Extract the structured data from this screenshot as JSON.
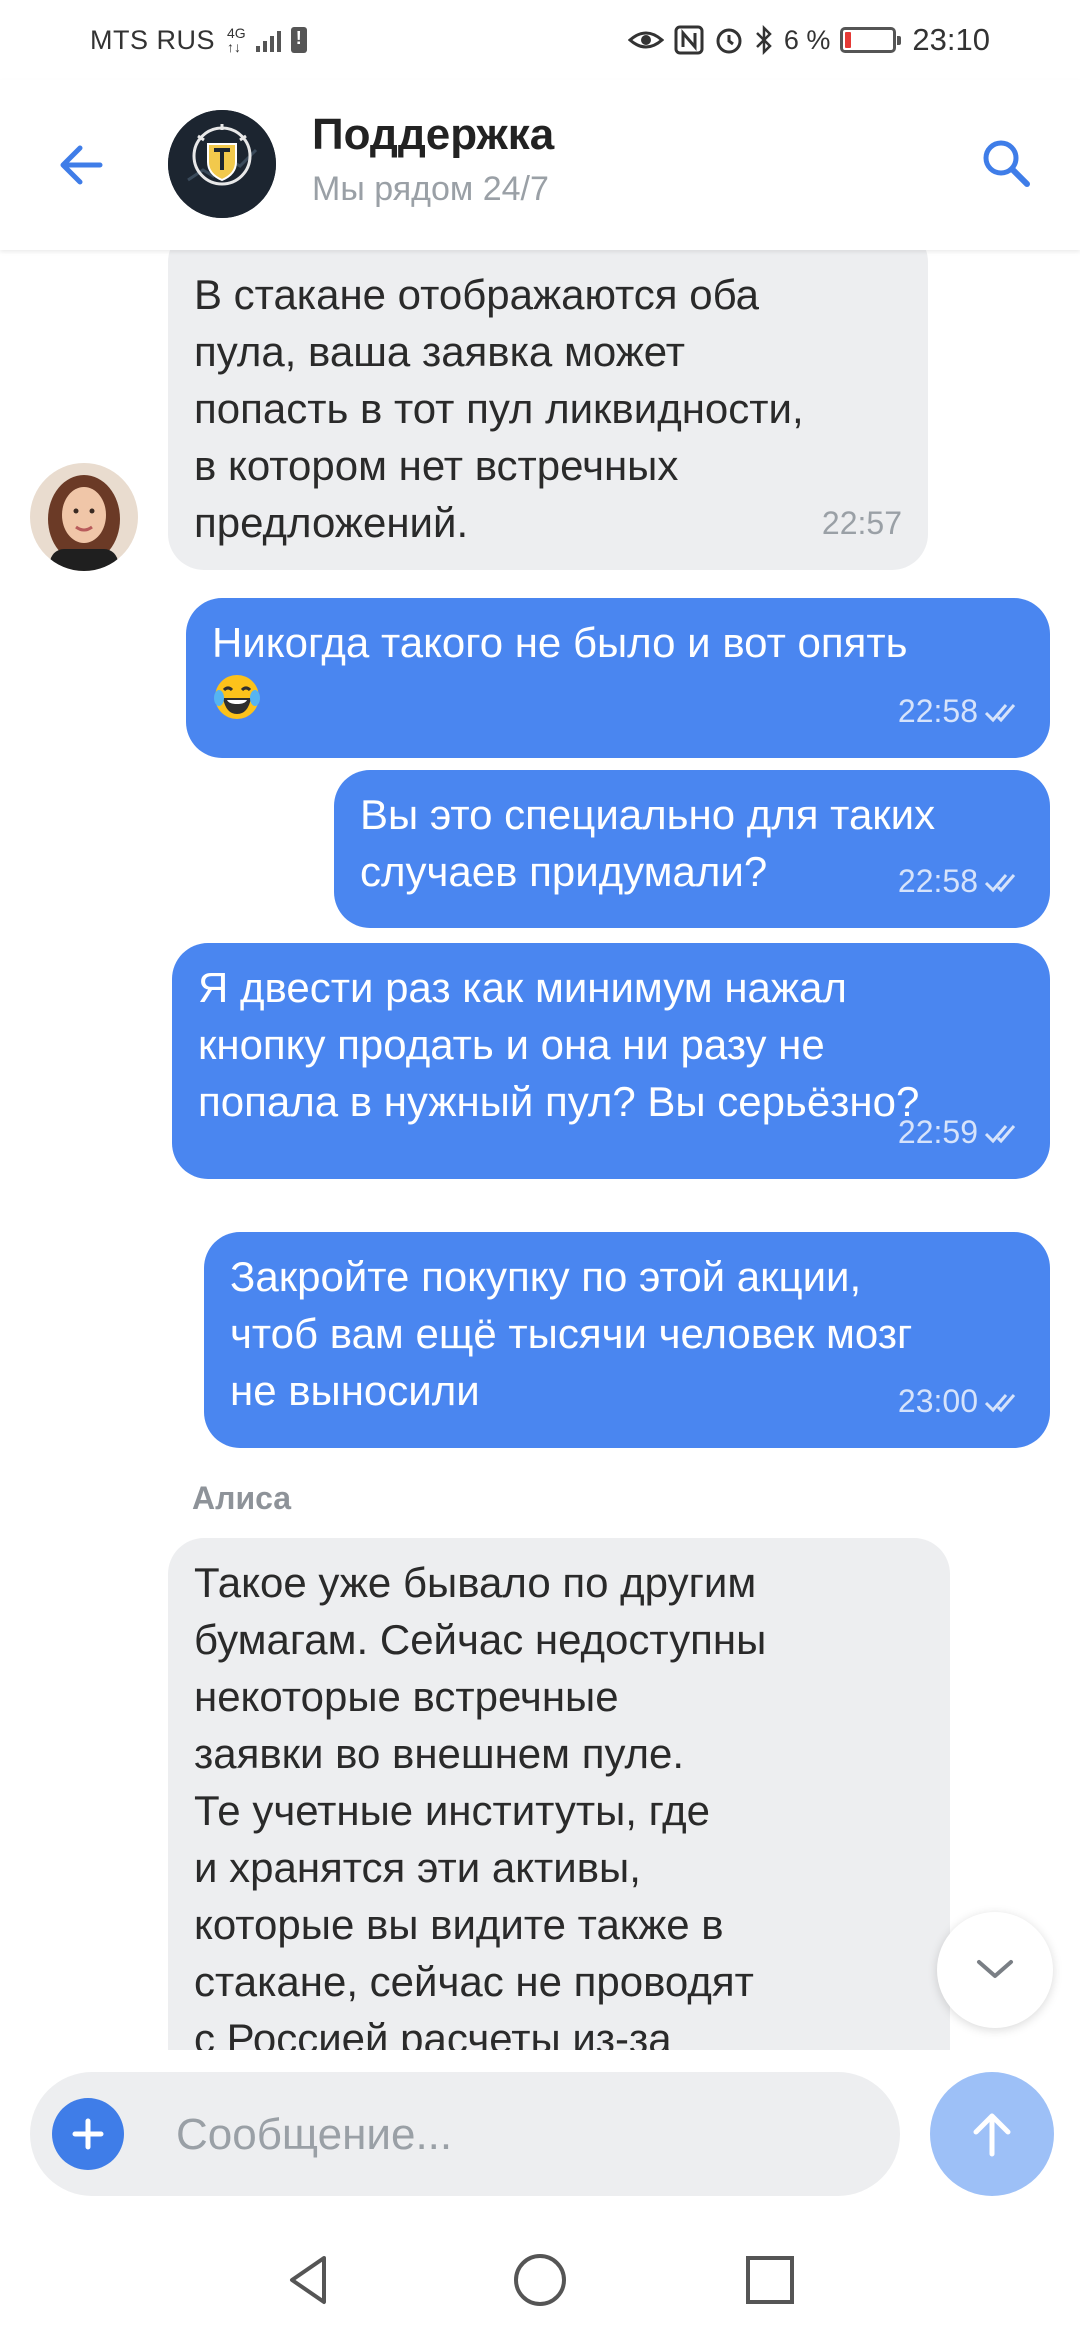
{
  "status_bar": {
    "carrier": "MTS RUS",
    "network_top": "4G",
    "network_bottom": "↑↓",
    "battery_percent": "6 %",
    "time": "23:10",
    "icons": [
      "eye-icon",
      "nfc-icon",
      "alarm-icon",
      "bluetooth-icon",
      "battery-icon"
    ]
  },
  "header": {
    "title": "Поддержка",
    "subtitle": "Мы рядом 24/7",
    "back_icon": "arrow-left-icon",
    "search_icon": "search-icon"
  },
  "messages": [
    {
      "direction": "incoming",
      "text": "В стакане отображаются оба\nпула, ваша заявка может\nпопасть в тот пул ликвидности,\nв котором нет встречных\nпредложений.",
      "time": "22:57"
    },
    {
      "direction": "outgoing",
      "text": "Никогда такого не было и вот опять",
      "emoji": "laughing-tears-emoji",
      "time": "22:58",
      "read": true
    },
    {
      "direction": "outgoing",
      "text": "Вы это специально для таких\nслучаев придумали?",
      "time": "22:58",
      "read": true
    },
    {
      "direction": "outgoing",
      "text": "Я двести раз как минимум нажал\nкнопку продать и она ни разу не\nпопала в нужный пул? Вы серьёзно?",
      "time": "22:59",
      "read": true
    },
    {
      "direction": "outgoing",
      "text": "Закройте покупку по этой акции,\nчтоб вам ещё тысячи человек мозг\nне выносили",
      "time": "23:00",
      "read": true
    },
    {
      "direction": "incoming",
      "sender": "Алиса",
      "text": "Такое уже бывало по другим\nбумагам. Сейчас недоступны\nнекоторые встречные\nзаявки во внешнем пуле.\nТе учетные институты, где\nи хранятся эти активы,\nкоторые вы видите также в\nстакане, сейчас не проводят\nс Россией расчеты из-за"
    }
  ],
  "composer": {
    "placeholder": "Сообщение..."
  },
  "colors": {
    "accent": "#3f7de8",
    "outgoing_bubble": "#4a86f0",
    "incoming_bubble": "#edeef0",
    "send_button_disabled": "#9dc0f7"
  },
  "nav": [
    "back-triangle-icon",
    "home-circle-icon",
    "recents-square-icon"
  ]
}
